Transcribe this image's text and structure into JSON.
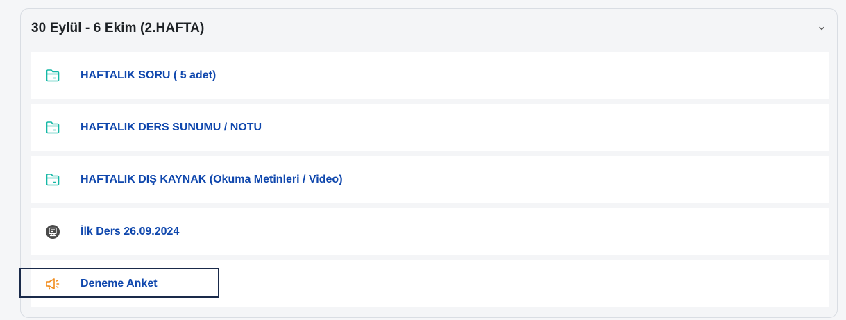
{
  "section": {
    "title": "30 Eylül - 6 Ekim (2.HAFTA)",
    "toggle_icon": "chevron-down-icon"
  },
  "activities": [
    {
      "label": "HAFTALIK SORU ( 5 adet)",
      "icon": "folder-icon",
      "icon_color": "#15b8a6"
    },
    {
      "label": "HAFTALIK DERS SUNUMU / NOTU",
      "icon": "folder-icon",
      "icon_color": "#15b8a6"
    },
    {
      "label": "HAFTALIK DIŞ KAYNAK (Okuma Metinleri / Video)",
      "icon": "folder-icon",
      "icon_color": "#15b8a6"
    },
    {
      "label": "İlk Ders 26.09.2024",
      "icon": "video-conference-icon",
      "icon_color": "#4a4a4a"
    },
    {
      "label": "Deneme Anket",
      "icon": "megaphone-icon",
      "icon_color": "#f28c1c"
    }
  ],
  "colors": {
    "link": "#0f47ad",
    "background": "#f5f6f8",
    "card_border": "#d9dde3",
    "focus_outline": "#1a2a4a"
  }
}
